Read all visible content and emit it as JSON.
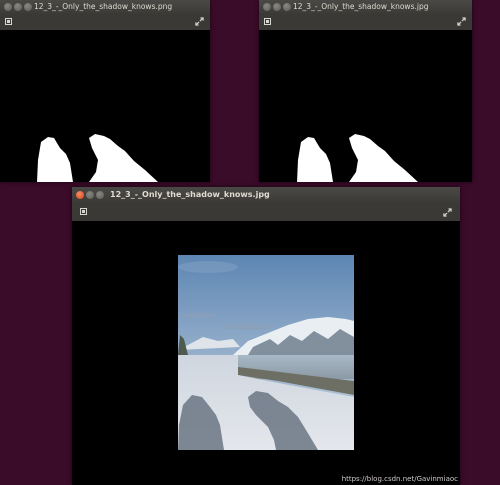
{
  "windows": {
    "top_left": {
      "title": "12_3_-_Only_the_shadow_knows.png"
    },
    "top_right": {
      "title": "12_3_-_Only_the_shadow_knows.jpg"
    },
    "bottom": {
      "title": "12_3_-_Only_the_shadow_knows.jpg"
    }
  },
  "icons": {
    "close": "close-icon",
    "minimize": "minimize-icon",
    "maximize": "maximize-icon",
    "pin": "pin-icon",
    "expand": "expand-icon"
  },
  "watermark": "https://blog.csdn.net/Gavinmiaoc",
  "colors": {
    "desktop": "#3b0b2a",
    "titlebar": "#3b3a36",
    "close_active": "#e0501f",
    "mask_white": "#ffffff",
    "canvas": "#000000"
  }
}
